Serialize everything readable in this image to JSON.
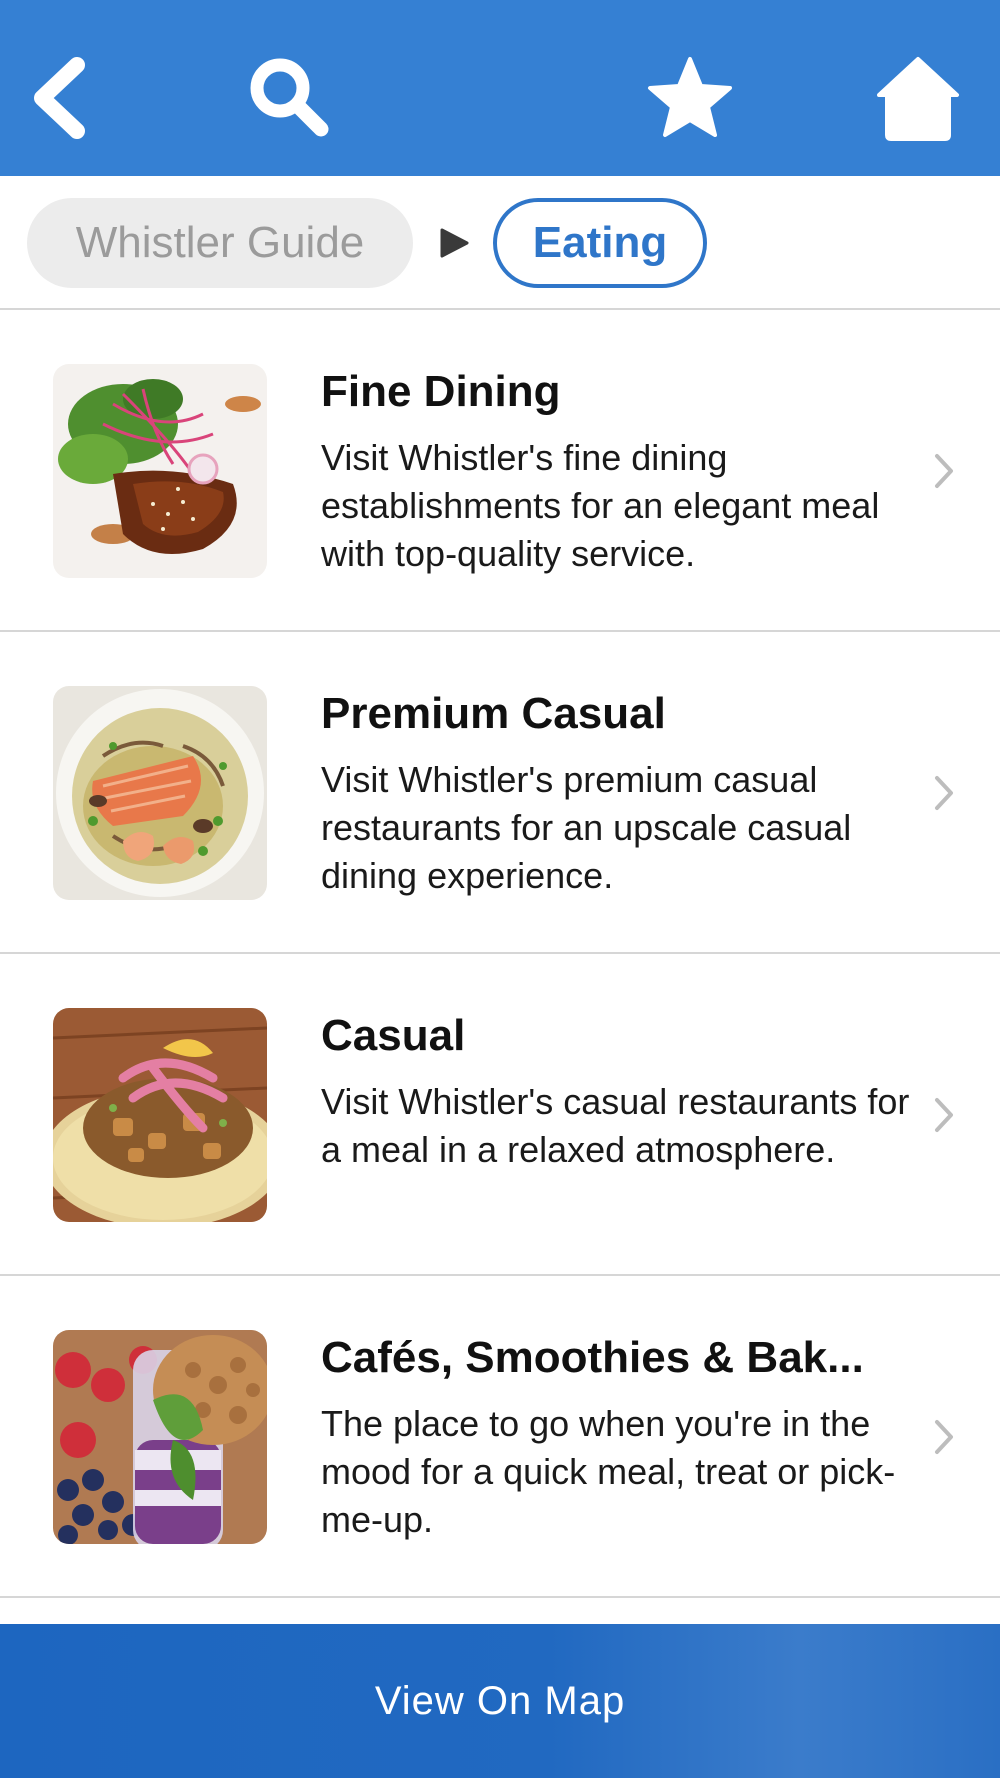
{
  "header": {
    "back_icon": "chevron-left-icon",
    "search_icon": "search-icon",
    "favorites_icon": "star-icon",
    "home_icon": "home-icon",
    "background_color": "#3580d3"
  },
  "breadcrumb": {
    "root_label": "Whistler Guide",
    "current_label": "Eating",
    "accent_color": "#2f76c9"
  },
  "categories": [
    {
      "title": "Fine Dining",
      "description": "Visit Whistler's fine dining establishments for an elegant meal with top-quality service.",
      "image": "seared-fish-with-salad-photo"
    },
    {
      "title": "Premium Casual",
      "description": "Visit Whistler's premium casual restaurants for an upscale casual dining experience.",
      "image": "salmon-with-shrimp-photo"
    },
    {
      "title": "Casual",
      "description": "Visit Whistler's casual restaurants for a meal in a relaxed atmosphere.",
      "image": "taco-with-pickled-onions-photo"
    },
    {
      "title": "Cafés, Smoothies & Bak...",
      "description": "The place to go when you're in the mood for a quick meal, treat or pick-me-up.",
      "image": "parfait-with-berries-photo"
    }
  ],
  "footer": {
    "map_button_label": "View On Map"
  }
}
